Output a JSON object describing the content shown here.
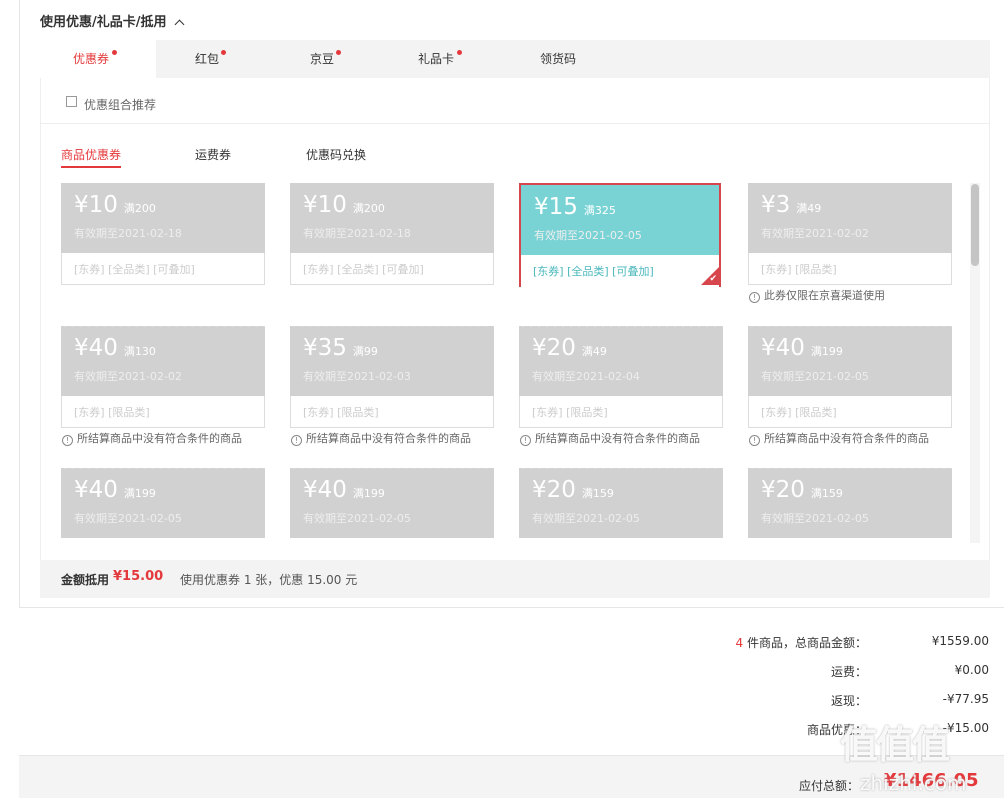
{
  "section_title": "使用优惠/礼品卡/抵用",
  "tabs": [
    {
      "label": "优惠券",
      "dot": true
    },
    {
      "label": "红包",
      "dot": true
    },
    {
      "label": "京豆",
      "dot": true
    },
    {
      "label": "礼品卡",
      "dot": true
    },
    {
      "label": "领货码",
      "dot": false
    }
  ],
  "combo_label": "优惠组合推荐",
  "subtabs": [
    "商品优惠券",
    "运费券",
    "优惠码兑换"
  ],
  "coupons": [
    {
      "amount": "¥10",
      "cond": "满200",
      "valid": "有效期至2021-02-18",
      "tags": "[东券]  [全品类]  [可叠加]",
      "warn": ""
    },
    {
      "amount": "¥10",
      "cond": "满200",
      "valid": "有效期至2021-02-18",
      "tags": "[东券]  [全品类]  [可叠加]",
      "warn": ""
    },
    {
      "amount": "¥15",
      "cond": "满325",
      "valid": "有效期至2021-02-05",
      "tags": "[东券]  [全品类]  [可叠加]",
      "warn": "",
      "selected": true
    },
    {
      "amount": "¥3",
      "cond": "满49",
      "valid": "有效期至2021-02-02",
      "tags": "[东券]  [限品类]",
      "warn": "此券仅限在京喜渠道使用"
    },
    {
      "amount": "¥40",
      "cond": "满130",
      "valid": "有效期至2021-02-02",
      "tags": "[东券]  [限品类]",
      "warn": "所结算商品中没有符合条件的商品"
    },
    {
      "amount": "¥35",
      "cond": "满99",
      "valid": "有效期至2021-02-03",
      "tags": "[东券]  [限品类]",
      "warn": "所结算商品中没有符合条件的商品"
    },
    {
      "amount": "¥20",
      "cond": "满49",
      "valid": "有效期至2021-02-04",
      "tags": "[东券]  [限品类]",
      "warn": "所结算商品中没有符合条件的商品"
    },
    {
      "amount": "¥40",
      "cond": "满199",
      "valid": "有效期至2021-02-05",
      "tags": "[东券]  [限品类]",
      "warn": "所结算商品中没有符合条件的商品"
    },
    {
      "amount": "¥40",
      "cond": "满199",
      "valid": "有效期至2021-02-05",
      "tags": "",
      "warn": ""
    },
    {
      "amount": "¥40",
      "cond": "满199",
      "valid": "有效期至2021-02-05",
      "tags": "",
      "warn": ""
    },
    {
      "amount": "¥20",
      "cond": "满159",
      "valid": "有效期至2021-02-05",
      "tags": "",
      "warn": ""
    },
    {
      "amount": "¥20",
      "cond": "满159",
      "valid": "有效期至2021-02-05",
      "tags": "",
      "warn": ""
    }
  ],
  "summary": {
    "label": "金额抵用",
    "amount": "¥15.00",
    "desc": "使用优惠券 1 张，优惠 15.00 元"
  },
  "totals": {
    "count": "4",
    "count_suffix": " 件商品，总商品金额：",
    "goods_total": "¥1559.00",
    "shipping_label": "运费：",
    "shipping": "¥0.00",
    "rebate_label": "返现：",
    "rebate": "-¥77.95",
    "discount_label": "商品优惠：",
    "discount": "-¥15.00",
    "payable_label": "应付总额：",
    "payable": "¥1466.05"
  },
  "watermark": {
    "logo": "值值值",
    "url": "zhizhi.com"
  },
  "colors": {
    "accent": "#e4393c",
    "selected_coupon": "#79d3d5",
    "disabled_coupon": "#d1d1d1"
  }
}
